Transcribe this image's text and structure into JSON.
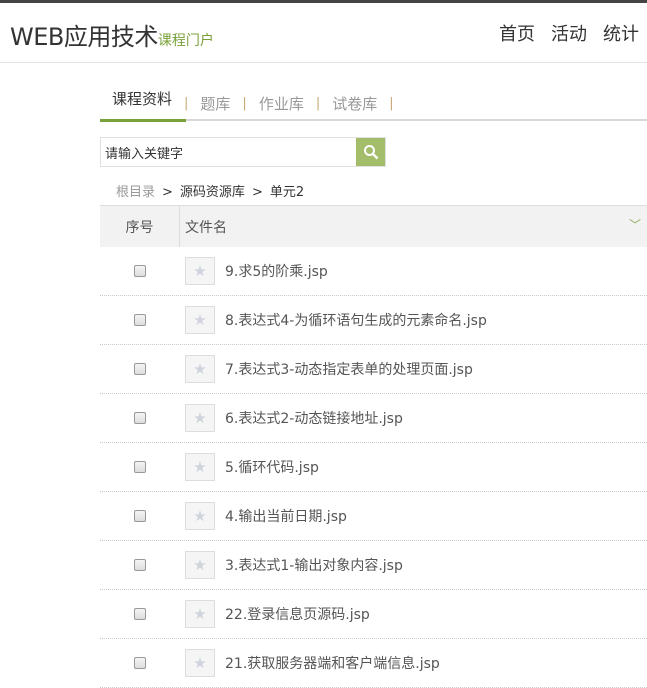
{
  "header": {
    "title": "WEB应用技术",
    "subtitle": "课程门户",
    "nav": [
      "首页",
      "活动",
      "统计"
    ]
  },
  "tabs": [
    "课程资料",
    "题库",
    "作业库",
    "试卷库"
  ],
  "search": {
    "placeholder": "请输入关键字"
  },
  "breadcrumb": [
    "根目录",
    "源码资源库",
    "单元2"
  ],
  "table": {
    "columns": [
      "序号",
      "文件名"
    ],
    "rows": [
      "9.求5的阶乘.jsp",
      "8.表达式4-为循环语句生成的元素命名.jsp",
      "7.表达式3-动态指定表单的处理页面.jsp",
      "6.表达式2-动态链接地址.jsp",
      "5.循环代码.jsp",
      "4.输出当前日期.jsp",
      "3.表达式1-输出对象内容.jsp",
      "22.登录信息页源码.jsp",
      "21.获取服务器端和客户端信息.jsp"
    ]
  }
}
